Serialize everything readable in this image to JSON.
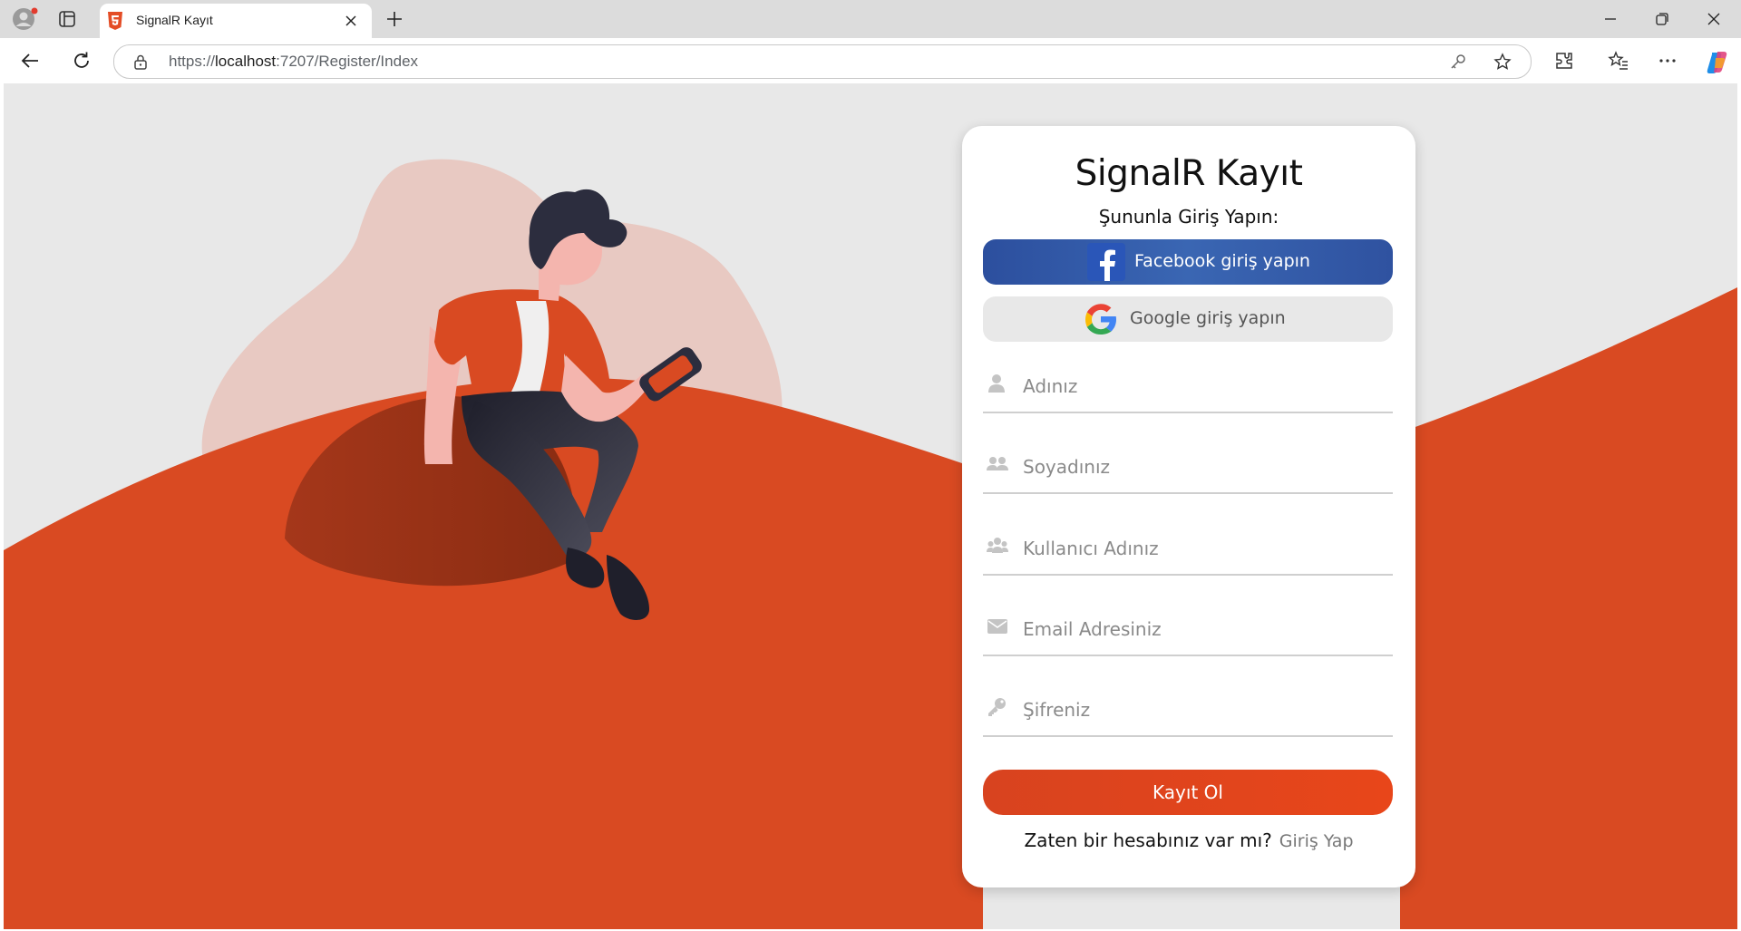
{
  "browser": {
    "tab_title": "SignalR Kayıt",
    "url_scheme": "https://",
    "url_host": "localhost",
    "url_path": ":7207/Register/Index"
  },
  "card": {
    "title": "SignalR Kayıt",
    "subtitle": "Şununla Giriş Yapın:",
    "facebook_label": "Facebook giriş yapın",
    "google_label": "Google giriş yapın",
    "fields": {
      "first_name": "Adınız",
      "last_name": "Soyadınız",
      "username": "Kullanıcı Adınız",
      "email": "Email Adresiniz",
      "password": "Şifreniz"
    },
    "submit_label": "Kayıt Ol",
    "footer_text": "Zaten bir hesabınız var mı?",
    "login_link": "Giriş Yap"
  },
  "colors": {
    "accent": "#d94a22",
    "facebook": "#2f55a4",
    "page_bg": "#e8e8e8"
  },
  "icons": [
    "user-icon",
    "users-icon",
    "user-group-icon",
    "envelope-icon",
    "key-icon",
    "facebook-icon",
    "google-icon"
  ]
}
